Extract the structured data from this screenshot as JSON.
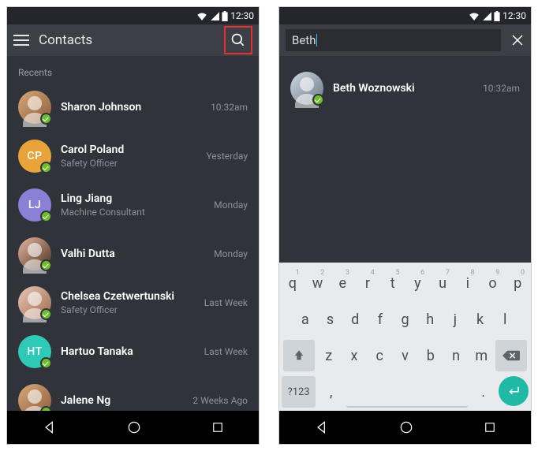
{
  "status": {
    "time": "12:30"
  },
  "left": {
    "title": "Contacts",
    "section": "Recents",
    "contacts": [
      {
        "name": "Sharon Johnson",
        "sub": "",
        "time": "10:32am",
        "avatar": {
          "type": "photo",
          "cls": "photo"
        }
      },
      {
        "name": "Carol Poland",
        "sub": "Safety Officer",
        "time": "Yesterday",
        "avatar": {
          "type": "initials",
          "text": "CP",
          "color": "#e8a33a"
        }
      },
      {
        "name": "Ling Jiang",
        "sub": "Machine Consultant",
        "time": "Monday",
        "avatar": {
          "type": "initials",
          "text": "LJ",
          "color": "#8b7fd6"
        }
      },
      {
        "name": "Valhi Dutta",
        "sub": "",
        "time": "Monday",
        "avatar": {
          "type": "photo",
          "cls": "photo2"
        }
      },
      {
        "name": "Chelsea Czetwertunski",
        "sub": "Safety Officer",
        "time": "Last Week",
        "avatar": {
          "type": "photo",
          "cls": "photo3"
        }
      },
      {
        "name": "Hartuo Tanaka",
        "sub": "",
        "time": "Last Week",
        "avatar": {
          "type": "initials",
          "text": "HT",
          "color": "#2fc9b8"
        }
      },
      {
        "name": "Jalene Ng",
        "sub": "",
        "time": "2 Weeks Ago",
        "avatar": {
          "type": "photo",
          "cls": "photo"
        }
      }
    ]
  },
  "right": {
    "search_value": "Beth",
    "results": [
      {
        "name": "Beth Woznowski",
        "sub": "",
        "time": "10:32am",
        "avatar": {
          "type": "photo",
          "cls": "photo4"
        }
      }
    ]
  },
  "keyboard": {
    "row1": [
      {
        "k": "q",
        "h": "1"
      },
      {
        "k": "w",
        "h": "2"
      },
      {
        "k": "e",
        "h": "3"
      },
      {
        "k": "r",
        "h": "4"
      },
      {
        "k": "t",
        "h": "5"
      },
      {
        "k": "y",
        "h": "6"
      },
      {
        "k": "u",
        "h": "7"
      },
      {
        "k": "i",
        "h": "8"
      },
      {
        "k": "o",
        "h": "9"
      },
      {
        "k": "p",
        "h": "0"
      }
    ],
    "row2": [
      "a",
      "s",
      "d",
      "f",
      "g",
      "h",
      "j",
      "k",
      "l"
    ],
    "row3": [
      "z",
      "x",
      "c",
      "v",
      "b",
      "n",
      "m"
    ],
    "row4": {
      "sym": "?123",
      "comma": ",",
      "period": "."
    }
  }
}
